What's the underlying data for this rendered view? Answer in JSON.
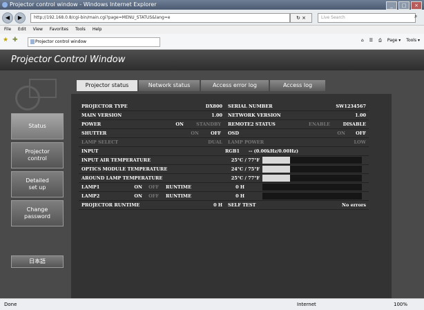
{
  "window": {
    "title": "Projector control window - Windows Internet Explorer",
    "url": "http://192.168.0.8/cgi-bin/main.cgi?page=MENU_STATUS&lang=e",
    "search_placeholder": "Live Search",
    "menu": [
      "File",
      "Edit",
      "View",
      "Favorites",
      "Tools",
      "Help"
    ],
    "tab_title": "Projector control window",
    "toolbar_right": [
      "Page ▾",
      "Tools ▾"
    ]
  },
  "app": {
    "title": "Projector Control Window",
    "sidebar": [
      {
        "label": "Status",
        "active": true
      },
      {
        "label": "Projector\ncontrol",
        "active": false
      },
      {
        "label": "Detailed\nset up",
        "active": false
      },
      {
        "label": "Change\npassword",
        "active": false
      },
      {
        "label": "日本語",
        "active": false
      }
    ],
    "tabs": [
      {
        "label": "Projector status",
        "active": true
      },
      {
        "label": "Network status",
        "active": false
      },
      {
        "label": "Access error log",
        "active": false
      },
      {
        "label": "Access log",
        "active": false
      }
    ]
  },
  "status": {
    "projector_type": {
      "label": "PROJECTOR TYPE",
      "value": "DX800"
    },
    "serial_number": {
      "label": "SERIAL NUMBER",
      "value": "SW1234567"
    },
    "main_version": {
      "label": "MAIN VERSION",
      "value": "1.00"
    },
    "network_version": {
      "label": "NETWORK VERSION",
      "value": "1.00"
    },
    "power": {
      "label": "POWER",
      "on": "ON",
      "standby": "STANDBY"
    },
    "remote2": {
      "label": "REMOTE2 STATUS",
      "enable": "ENABLE",
      "disable": "DISABLE"
    },
    "shutter": {
      "label": "SHUTTER",
      "on": "ON",
      "off": "OFF"
    },
    "osd": {
      "label": "OSD",
      "on": "ON",
      "off": "OFF"
    },
    "lamp_select": {
      "label": "LAMP SELECT",
      "value": "DUAL"
    },
    "lamp_power": {
      "label": "LAMP POWER",
      "value": "LOW"
    },
    "input": {
      "label": "INPUT",
      "value": "RGB1",
      "signal": "-- (0.00kHz/0.00Hz)"
    },
    "temps": [
      {
        "label": "INPUT AIR TEMPERATURE",
        "value": "25°C / 77°F",
        "level": 0.28
      },
      {
        "label": "OPTICS MODULE TEMPERATURE",
        "value": "24°C / 75°F",
        "level": 0.28
      },
      {
        "label": "AROUND LAMP TEMPERATURE",
        "value": "25°C / 77°F",
        "level": 0.28
      }
    ],
    "lamps": [
      {
        "label": "LAMP1",
        "on": "ON",
        "off": "OFF",
        "runtime_label": "RUNTIME",
        "runtime": "0 H",
        "level": 0.0
      },
      {
        "label": "LAMP2",
        "on": "ON",
        "off": "OFF",
        "runtime_label": "RUNTIME",
        "runtime": "0 H",
        "level": 0.0
      }
    ],
    "projector_runtime": {
      "label": "PROJECTOR RUNTIME",
      "value": "0 H"
    },
    "self_test": {
      "label": "SELF TEST",
      "value": "No errors"
    }
  },
  "statusbar": {
    "left": "Done",
    "zone": "Internet",
    "zoom": "100%"
  }
}
